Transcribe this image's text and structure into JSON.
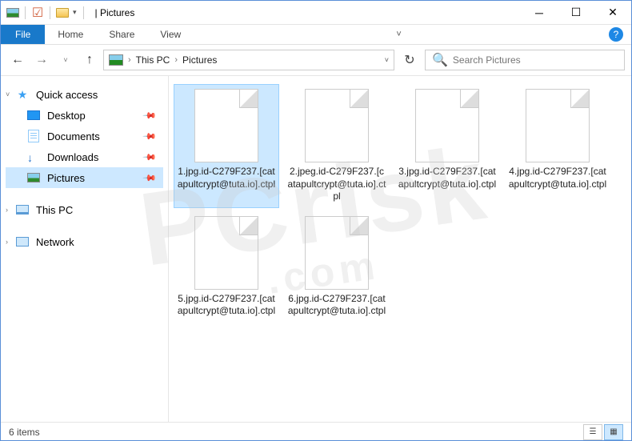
{
  "title": "Pictures",
  "ribbon": {
    "file": "File",
    "tabs": [
      "Home",
      "Share",
      "View"
    ]
  },
  "breadcrumb": {
    "root": "This PC",
    "current": "Pictures"
  },
  "search": {
    "placeholder": "Search Pictures"
  },
  "nav": {
    "quick_access": "Quick access",
    "pinned": [
      {
        "label": "Desktop",
        "icon": "desktop"
      },
      {
        "label": "Documents",
        "icon": "docs"
      },
      {
        "label": "Downloads",
        "icon": "down"
      },
      {
        "label": "Pictures",
        "icon": "pic",
        "selected": true
      }
    ],
    "this_pc": "This PC",
    "network": "Network"
  },
  "files": [
    {
      "name": "1.jpg.id-C279F237.[catapultcrypt@tuta.io].ctpl",
      "selected": true
    },
    {
      "name": "2.jpeg.id-C279F237.[catapultcrypt@tuta.io].ctpl"
    },
    {
      "name": "3.jpg.id-C279F237.[catapultcrypt@tuta.io].ctpl"
    },
    {
      "name": "4.jpg.id-C279F237.[catapultcrypt@tuta.io].ctpl"
    },
    {
      "name": "5.jpg.id-C279F237.[catapultcrypt@tuta.io].ctpl"
    },
    {
      "name": "6.jpg.id-C279F237.[catapultcrypt@tuta.io].ctpl"
    }
  ],
  "status": {
    "count": "6 items"
  },
  "watermark": {
    "main": "PCrisk",
    "sub": ".com"
  }
}
